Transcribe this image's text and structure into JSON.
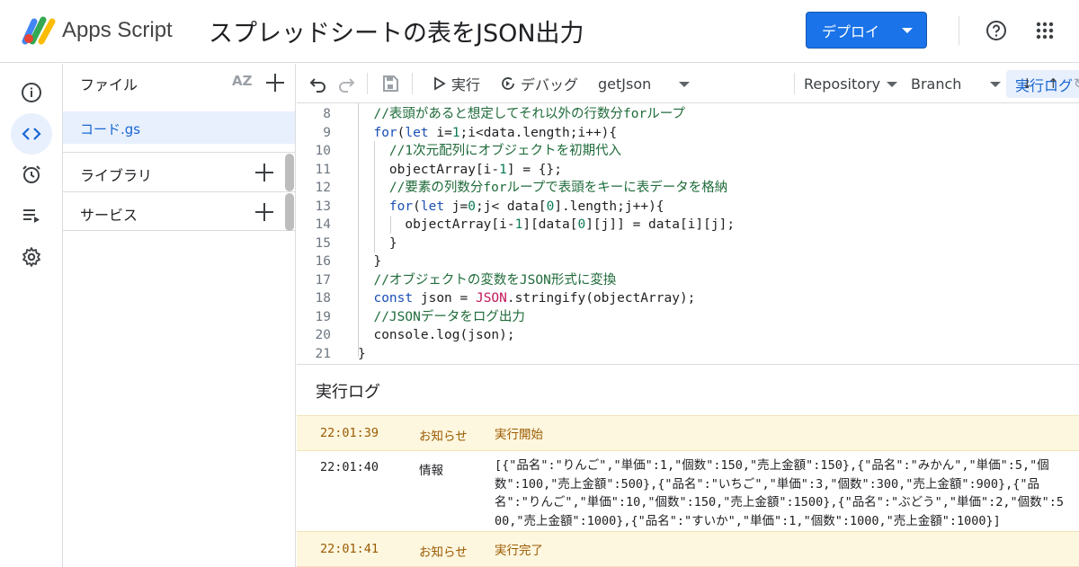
{
  "header": {
    "app_name": "Apps Script",
    "project_title": "スプレッドシートの表をJSON出力",
    "deploy_label": "デプロイ"
  },
  "rail": {
    "items": [
      "info-icon",
      "code-icon",
      "alarm-icon",
      "executions-icon",
      "gear-icon"
    ]
  },
  "files": {
    "title": "ファイル",
    "sort_label": "AZ",
    "items": [
      {
        "name": "コード.gs"
      }
    ],
    "libraries_label": "ライブラリ",
    "services_label": "サービス"
  },
  "toolbar": {
    "run_label": "実行",
    "debug_label": "デバッグ",
    "function_name": "getJson",
    "log_button": "実行ログ",
    "repository_label": "Repository",
    "branch_label": "Branch"
  },
  "editor": {
    "lines": [
      {
        "n": "8",
        "t": "  //表頭があると想定してそれ以外の行数分forループ"
      },
      {
        "n": "9",
        "t": "  for(let i=1;i<data.length;i++){"
      },
      {
        "n": "10",
        "t": "    //1次元配列にオブジェクトを初期代入"
      },
      {
        "n": "11",
        "t": "    objectArray[i-1] = {};"
      },
      {
        "n": "12",
        "t": "    //要素の列数分forループで表頭をキーに表データを格納"
      },
      {
        "n": "13",
        "t": "    for(let j=0;j< data[0].length;j++){"
      },
      {
        "n": "14",
        "t": "      objectArray[i-1][data[0][j]] = data[i][j];"
      },
      {
        "n": "15",
        "t": "    }"
      },
      {
        "n": "16",
        "t": "  }"
      },
      {
        "n": "17",
        "t": "  //オブジェクトの変数をJSON形式に変換"
      },
      {
        "n": "18",
        "t": "  const json = JSON.stringify(objectArray);"
      },
      {
        "n": "19",
        "t": "  //JSONデータをログ出力"
      },
      {
        "n": "20",
        "t": "  console.log(json);"
      },
      {
        "n": "21",
        "t": "}"
      }
    ]
  },
  "log": {
    "title": "実行ログ",
    "rows": [
      {
        "time": "22:01:39",
        "level": "お知らせ",
        "message": "実行開始",
        "kind": "notice"
      },
      {
        "time": "22:01:40",
        "level": "情報",
        "message": "[{\"品名\":\"りんご\",\"単価\":1,\"個数\":150,\"売上金額\":150},{\"品名\":\"みかん\",\"単価\":5,\"個数\":100,\"売上金額\":500},{\"品名\":\"いちご\",\"単価\":3,\"個数\":300,\"売上金額\":900},{\"品名\":\"りんご\",\"単価\":10,\"個数\":150,\"売上金額\":1500},{\"品名\":\"ぶどう\",\"単価\":2,\"個数\":500,\"売上金額\":1000},{\"品名\":\"すいか\",\"単価\":1,\"個数\":1000,\"売上金額\":1000}]",
        "kind": "info"
      },
      {
        "time": "22:01:41",
        "level": "お知らせ",
        "message": "実行完了",
        "kind": "notice"
      }
    ]
  }
}
